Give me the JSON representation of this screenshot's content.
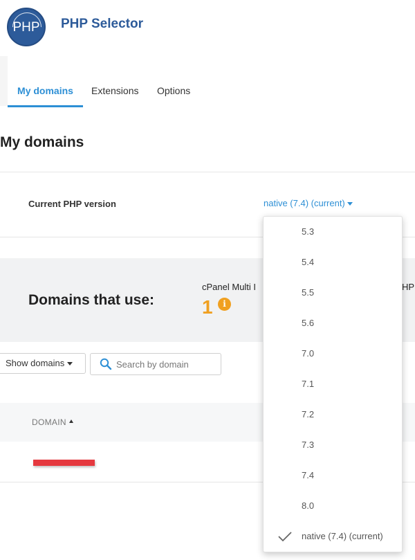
{
  "app": {
    "logo_text": "PHP",
    "title": "PHP Selector"
  },
  "tabs": [
    {
      "label": "My domains",
      "active": true
    },
    {
      "label": "Extensions",
      "active": false
    },
    {
      "label": "Options",
      "active": false
    }
  ],
  "page": {
    "title": "My domains"
  },
  "php_version": {
    "label": "Current PHP version",
    "value": "native (7.4) (current)"
  },
  "domains_panel": {
    "title": "Domains that use:",
    "subtitle": "cPanel Multi I",
    "subtitle_right": "HP",
    "count": "1",
    "info_icon": "i"
  },
  "filter": {
    "show_domains_label": "Show domains",
    "search_placeholder": "Search by domain"
  },
  "table": {
    "columns": [
      {
        "label": "DOMAIN",
        "sort": "ascending"
      }
    ]
  },
  "dropdown": {
    "options": [
      {
        "label": "5.3",
        "checked": false
      },
      {
        "label": "5.4",
        "checked": false
      },
      {
        "label": "5.5",
        "checked": false
      },
      {
        "label": "5.6",
        "checked": false
      },
      {
        "label": "7.0",
        "checked": false
      },
      {
        "label": "7.1",
        "checked": false
      },
      {
        "label": "7.2",
        "checked": false
      },
      {
        "label": "7.3",
        "checked": false
      },
      {
        "label": "7.4",
        "checked": false
      },
      {
        "label": "8.0",
        "checked": false
      },
      {
        "label": "native (7.4) (current)",
        "checked": true
      }
    ]
  },
  "colors": {
    "brand": "#2d5b9a",
    "accent": "#2d8fd5",
    "count": "#f0a020",
    "redacted": "#e5393f"
  }
}
